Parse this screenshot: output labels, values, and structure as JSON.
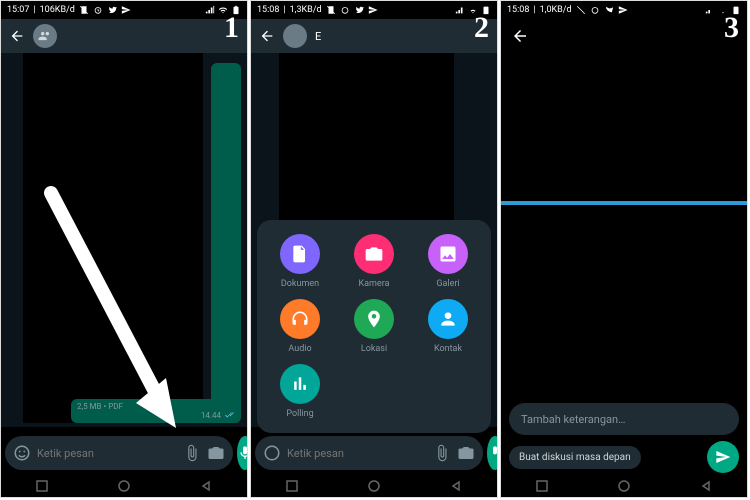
{
  "status": {
    "p1_time": "15:07",
    "p1_net": "106KB/d",
    "p2_time": "15:08",
    "p2_net": "1,3KB/d",
    "p3_time": "15:08",
    "p3_net": "1,0KB/d"
  },
  "steps": {
    "s1": "1",
    "s2": "2",
    "s3": "3"
  },
  "chat": {
    "placeholder": "Ketik pesan",
    "pdf_meta": "2,5 MB • PDF",
    "time_tick": "14.44",
    "file_hint": "6.png"
  },
  "attach": {
    "items": [
      {
        "label": "Dokumen",
        "color": "#7f66ff",
        "icon": "doc"
      },
      {
        "label": "Kamera",
        "color": "#ff2e74",
        "icon": "cam"
      },
      {
        "label": "Galeri",
        "color": "#c861fa",
        "icon": "gal"
      },
      {
        "label": "Audio",
        "color": "#ff7a29",
        "icon": "aud"
      },
      {
        "label": "Lokasi",
        "color": "#1fa855",
        "icon": "loc"
      },
      {
        "label": "Kontak",
        "color": "#0eabf4",
        "icon": "con"
      },
      {
        "label": "Polling",
        "color": "#02a698",
        "icon": "pol"
      }
    ]
  },
  "p3": {
    "caption_placeholder": "Tambah keterangan…",
    "recipient_chip": "Buat diskusi masa depan"
  },
  "colors": {
    "accent": "#00a884",
    "sheet": "#1f2c34"
  }
}
